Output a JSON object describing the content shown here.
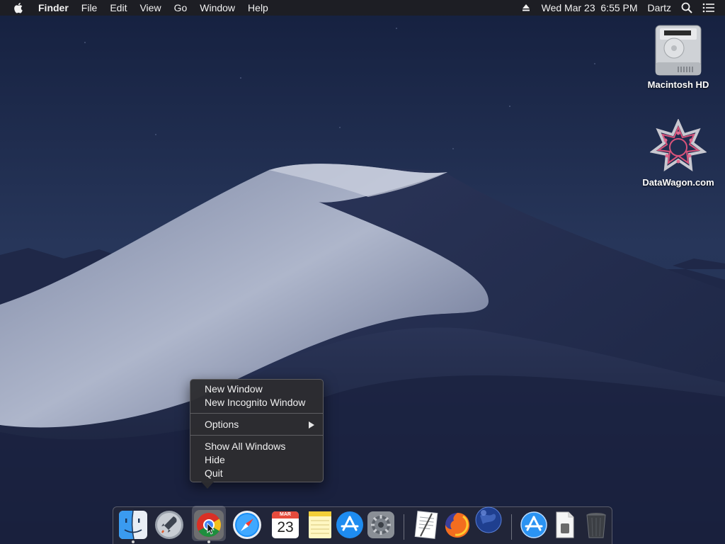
{
  "menubar": {
    "apple_icon": "apple-logo-icon",
    "items": [
      "Finder",
      "File",
      "Edit",
      "View",
      "Go",
      "Window",
      "Help"
    ],
    "clock": "Wed Mar 23  6:55 PM",
    "user": "Dartz",
    "icons": [
      "eject-icon",
      "spotlight-search-icon",
      "notification-center-icon"
    ]
  },
  "desktop": {
    "icons": [
      {
        "label": "Macintosh HD",
        "icon": "hard-drive-icon"
      },
      {
        "label": "DataWagon.com",
        "icon": "datawagon-logo-icon"
      }
    ]
  },
  "context_menu": {
    "items": [
      {
        "label": "New Window"
      },
      {
        "label": "New Incognito Window"
      },
      {
        "label": "Options",
        "has_submenu": true
      },
      {
        "label": "Show All Windows"
      },
      {
        "label": "Hide"
      },
      {
        "label": "Quit"
      }
    ]
  },
  "dock": {
    "apps": [
      {
        "name": "Finder",
        "icon": "finder-icon",
        "running": true
      },
      {
        "name": "Launchpad",
        "icon": "launchpad-rocket-icon",
        "running": false
      },
      {
        "name": "Google Chrome",
        "icon": "chrome-icon",
        "running": true,
        "hovered": true
      },
      {
        "name": "Safari",
        "icon": "safari-compass-icon",
        "running": false
      },
      {
        "name": "Calendar",
        "icon": "calendar-icon",
        "running": false,
        "month": "MAR",
        "day": "23"
      },
      {
        "name": "Notes",
        "icon": "notes-icon",
        "running": false
      },
      {
        "name": "App Store",
        "icon": "app-store-icon",
        "running": false
      },
      {
        "name": "System Preferences",
        "icon": "gear-icon",
        "running": false
      },
      {
        "name": "TextEdit",
        "icon": "textedit-icon",
        "running": false
      },
      {
        "name": "Firefox",
        "icon": "firefox-icon",
        "running": false
      },
      {
        "name": "Network Radar",
        "icon": "globe-icon",
        "running": false
      },
      {
        "name": "Applications",
        "icon": "app-store-folder-icon",
        "running": false
      },
      {
        "name": "Documents",
        "icon": "document-stack-icon",
        "running": false
      },
      {
        "name": "Trash",
        "icon": "trash-icon",
        "running": false
      }
    ]
  },
  "colors": {
    "sky_top": "#1a2447",
    "sky_bottom": "#2f3e63",
    "dune_light": "#c3c9d8",
    "dune_shadow": "#232c4d",
    "menu_bg": "#2d2d30",
    "chrome_red": "#d93025",
    "chrome_green": "#1e8e3e",
    "chrome_yellow": "#f2c01c",
    "chrome_blue": "#4285f4"
  }
}
